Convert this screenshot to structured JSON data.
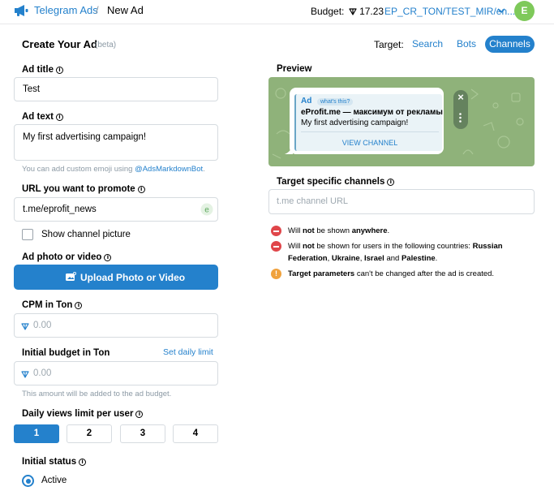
{
  "header": {
    "brand": "Telegram Ads",
    "separator": "/",
    "crumb": "New Ad",
    "budget_label": "Budget:",
    "budget_value": "17.23",
    "account": "EP_CR_TON/TEST_MIR/en...",
    "avatar_letter": "E"
  },
  "form": {
    "title": "Create Your Ad",
    "beta": "(beta)",
    "ad_title_label": "Ad title",
    "ad_title_value": "Test",
    "ad_text_label": "Ad text",
    "ad_text_value": "My first advertising campaign!",
    "emoji_hint_prefix": "You can add custom emoji using",
    "emoji_hint_link": "@AdsMarkdownBot",
    "emoji_hint_suffix": ".",
    "url_label": "URL you want to promote",
    "url_value": "t.me/eprofit_news",
    "show_picture_label": "Show channel picture",
    "photo_label": "Ad photo or video",
    "upload_button": "Upload Photo or Video",
    "cpm_label": "CPM in Ton",
    "cpm_placeholder": "0.00",
    "budget_label": "Initial budget in Ton",
    "set_daily_limit": "Set daily limit",
    "budget_placeholder": "0.00",
    "budget_hint": "This amount will be added to the ad budget.",
    "daily_views_label": "Daily views limit per user",
    "daily_views_options": [
      "1",
      "2",
      "3",
      "4"
    ],
    "daily_views_selected": "1",
    "status_label": "Initial status",
    "status_option": "Active"
  },
  "targeting": {
    "label": "Target:",
    "tabs": [
      "Search",
      "Bots",
      "Channels"
    ],
    "active_tab": "Channels"
  },
  "preview": {
    "label": "Preview",
    "ad_tag": "Ad",
    "whats_this": "what's this?",
    "channel_line": "eProfit.me — максимум от рекламы",
    "message": "My first advertising campaign!",
    "view_button": "VIEW CHANNEL",
    "close_symbol": "×"
  },
  "channels": {
    "label": "Target specific channels",
    "placeholder": "t.me channel URL",
    "notice1_pre": "Will",
    "notice1_bold": "not",
    "notice1_mid": "be shown",
    "notice1_bold2": "anywhere",
    "notice1_post": ".",
    "notice2_line1_pre": "Will",
    "notice2_line1_bold": "not",
    "notice2_line1_mid": "be shown for users in the following countries:",
    "notice2_line1_bold2": "Russian",
    "notice2_line2_bold1": "Federation",
    "notice2_line2_sep1": ",",
    "notice2_line2_bold2": "Ukraine",
    "notice2_line2_sep2": ",",
    "notice2_line2_bold3": "Israel",
    "notice2_line2_and": "and",
    "notice2_line2_bold4": "Palestine",
    "notice2_line2_post": ".",
    "notice3_bold": "Target parameters",
    "notice3_post": "can't be changed after the ad is created.",
    "warn_symbol": "!"
  },
  "colors": {
    "accent": "#2481cc",
    "error": "#e0464a",
    "warning": "#f0a23d",
    "avatar": "#7ec95a"
  }
}
